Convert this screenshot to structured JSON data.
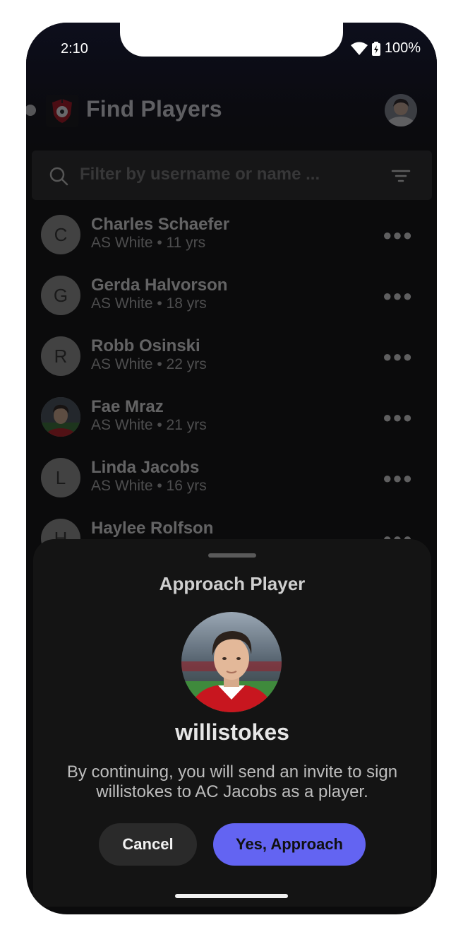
{
  "status_bar": {
    "time": "2:10",
    "battery": "100%"
  },
  "header": {
    "title": "Find Players"
  },
  "search": {
    "placeholder": "Filter by username or name ..."
  },
  "players": [
    {
      "initial": "C",
      "name": "Charles Schaefer",
      "meta": "AS White • 11 yrs"
    },
    {
      "initial": "G",
      "name": "Gerda Halvorson",
      "meta": "AS White • 18 yrs"
    },
    {
      "initial": "R",
      "name": "Robb Osinski",
      "meta": "AS White • 22 yrs"
    },
    {
      "initial": "",
      "name": "Fae Mraz",
      "meta": "AS White • 21 yrs",
      "has_photo": true
    },
    {
      "initial": "L",
      "name": "Linda Jacobs",
      "meta": "AS White • 16 yrs"
    },
    {
      "initial": "H",
      "name": "Haylee Rolfson",
      "meta": ""
    }
  ],
  "sheet": {
    "title": "Approach Player",
    "username": "willistokes",
    "description": "By continuing, you will send an invite to sign willistokes to AC Jacobs as a player.",
    "cancel_label": "Cancel",
    "approach_label": "Yes, Approach"
  },
  "colors": {
    "accent": "#6364f2",
    "sheet_bg": "#141414",
    "screen_bg": "#0b0b0c"
  }
}
